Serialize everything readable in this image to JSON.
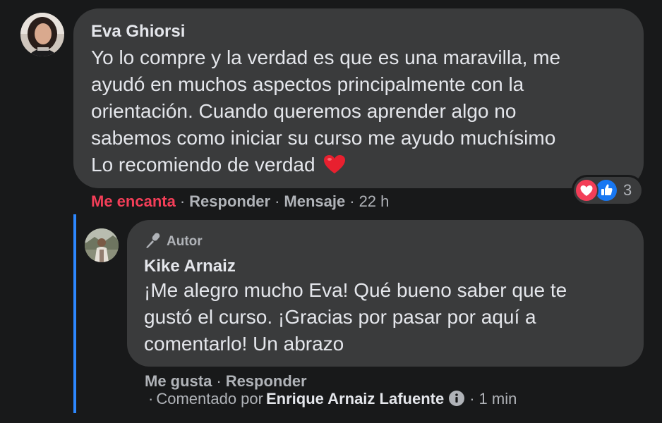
{
  "main_comment": {
    "author": "Eva Ghiorsi",
    "text_lines": [
      "Yo lo compre y la verdad es que es una maravilla, me",
      "ayudó en muchos aspectos principalmente con la",
      "orientación. Cuando queremos aprender algo no",
      "sabemos como iniciar su curso me ayudo muchísimo",
      "Lo recomiendo de verdad"
    ],
    "reactions": {
      "icons": [
        "heart-icon",
        "like-icon"
      ],
      "count": "3"
    },
    "actions": {
      "reaction_label": "Me encanta",
      "reply_label": "Responder",
      "message_label": "Mensaje",
      "time": "22 h"
    }
  },
  "reply_comment": {
    "badge_label": "Autor",
    "author": "Kike Arnaiz",
    "text_lines": [
      "¡Me alegro mucho Eva! Qué bueno saber que te",
      "gustó el curso. ¡Gracias por pasar por aquí a",
      "comentarlo! Un abrazo"
    ],
    "actions": {
      "like_label": "Me gusta",
      "reply_label": "Responder"
    },
    "commented_by": {
      "prefix": "Comentado por",
      "name": "Enrique Arnaiz Lafuente",
      "time": "1 min"
    }
  },
  "colors": {
    "background": "#18191a",
    "bubble": "#3a3b3c",
    "love_accent": "#f33e58",
    "like_blue": "#1877f2",
    "thread_line": "#2d88ff"
  }
}
